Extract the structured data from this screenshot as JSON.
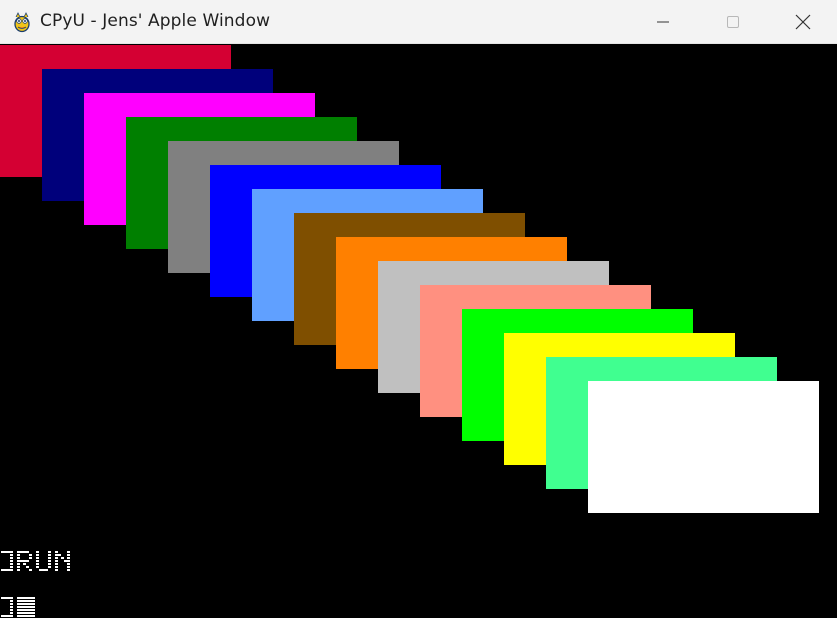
{
  "window": {
    "title": "CPyU - Jens' Apple Window",
    "icon": "pygame-snake-icon",
    "controls": [
      "minimize-icon",
      "maximize-icon",
      "close-icon"
    ]
  },
  "canvas": {
    "background": "#000000",
    "rectangles": [
      {
        "name": "red",
        "color": "#D40033"
      },
      {
        "name": "dark-blue",
        "color": "#00007B"
      },
      {
        "name": "magenta",
        "color": "#FF00FF"
      },
      {
        "name": "dark-green",
        "color": "#007F00"
      },
      {
        "name": "gray",
        "color": "#808080"
      },
      {
        "name": "blue",
        "color": "#0000FF"
      },
      {
        "name": "light-blue",
        "color": "#60A0FF"
      },
      {
        "name": "brown",
        "color": "#7F4F00"
      },
      {
        "name": "orange",
        "color": "#FF8000"
      },
      {
        "name": "light-gray",
        "color": "#C0C0C0"
      },
      {
        "name": "pink",
        "color": "#FF9080"
      },
      {
        "name": "green",
        "color": "#00FF00"
      },
      {
        "name": "yellow",
        "color": "#FFFF00"
      },
      {
        "name": "aqua",
        "color": "#40FF90"
      },
      {
        "name": "white",
        "color": "#FFFFFF"
      }
    ]
  },
  "terminal": {
    "prompt": "]",
    "command": "RUN",
    "cursor_line": "]"
  }
}
